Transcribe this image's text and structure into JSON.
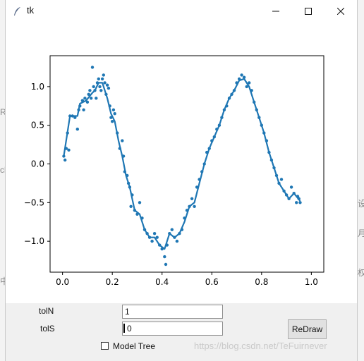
{
  "window": {
    "title": "tk"
  },
  "titlebar_icons": [
    "feather-icon",
    "minimize-icon",
    "maximize-icon",
    "close-icon"
  ],
  "controls": {
    "toln_label": "tolN",
    "toln_value": "1",
    "tols_label": "tolS",
    "tols_value": "0",
    "model_tree_label": "Model Tree",
    "model_tree_checked": false,
    "redraw_label": "ReDraw"
  },
  "watermark": "https://blog.csdn.net/TeFuirnever",
  "background_fragments": [
    "Re",
    "ch",
    "中",
    "设",
    "月",
    "权"
  ],
  "chart_data": {
    "type": "scatter",
    "xlim": [
      -0.05,
      1.05
    ],
    "ylim": [
      -1.4,
      1.4
    ],
    "xticks": [
      0.0,
      0.2,
      0.4,
      0.6,
      0.8,
      1.0
    ],
    "yticks": [
      -1.0,
      -0.5,
      0.0,
      0.5,
      1.0
    ],
    "xtick_labels": [
      "0.0",
      "0.2",
      "0.4",
      "0.6",
      "0.8",
      "1.0"
    ],
    "ytick_labels": [
      "−1.0",
      "−0.5",
      "0.0",
      "0.5",
      "1.0"
    ],
    "color": "#1f77b4",
    "scatter_points": [
      [
        0.005,
        0.1
      ],
      [
        0.01,
        0.05
      ],
      [
        0.015,
        0.2
      ],
      [
        0.02,
        0.4
      ],
      [
        0.025,
        0.18
      ],
      [
        0.03,
        0.62
      ],
      [
        0.04,
        0.62
      ],
      [
        0.05,
        0.6
      ],
      [
        0.06,
        0.45
      ],
      [
        0.065,
        0.7
      ],
      [
        0.07,
        0.75
      ],
      [
        0.08,
        0.82
      ],
      [
        0.085,
        0.7
      ],
      [
        0.09,
        0.85
      ],
      [
        0.1,
        0.8
      ],
      [
        0.105,
        0.9
      ],
      [
        0.11,
        0.95
      ],
      [
        0.115,
        0.85
      ],
      [
        0.12,
        1.25
      ],
      [
        0.125,
        1.0
      ],
      [
        0.13,
        0.95
      ],
      [
        0.135,
        0.85
      ],
      [
        0.14,
        1.05
      ],
      [
        0.145,
        1.1
      ],
      [
        0.15,
        1.0
      ],
      [
        0.155,
        0.95
      ],
      [
        0.16,
        1.1
      ],
      [
        0.165,
        1.15
      ],
      [
        0.17,
        1.05
      ],
      [
        0.175,
        0.9
      ],
      [
        0.18,
        1.02
      ],
      [
        0.185,
        0.98
      ],
      [
        0.19,
        0.75
      ],
      [
        0.195,
        0.6
      ],
      [
        0.2,
        0.55
      ],
      [
        0.205,
        0.7
      ],
      [
        0.21,
        0.65
      ],
      [
        0.22,
        0.4
      ],
      [
        0.23,
        0.2
      ],
      [
        0.24,
        0.3
      ],
      [
        0.245,
        0.1
      ],
      [
        0.25,
        -0.1
      ],
      [
        0.26,
        -0.15
      ],
      [
        0.265,
        -0.25
      ],
      [
        0.27,
        -0.3
      ],
      [
        0.275,
        -0.55
      ],
      [
        0.28,
        -0.4
      ],
      [
        0.29,
        -0.6
      ],
      [
        0.3,
        -0.65
      ],
      [
        0.31,
        -0.5
      ],
      [
        0.32,
        -0.7
      ],
      [
        0.33,
        -0.85
      ],
      [
        0.34,
        -0.9
      ],
      [
        0.35,
        -0.95
      ],
      [
        0.36,
        -1.0
      ],
      [
        0.37,
        -0.9
      ],
      [
        0.38,
        -0.95
      ],
      [
        0.39,
        -1.05
      ],
      [
        0.4,
        -1.1
      ],
      [
        0.41,
        -1.2
      ],
      [
        0.415,
        -1.3
      ],
      [
        0.42,
        -1.05
      ],
      [
        0.43,
        -0.9
      ],
      [
        0.44,
        -0.85
      ],
      [
        0.45,
        -0.95
      ],
      [
        0.46,
        -1.0
      ],
      [
        0.47,
        -0.9
      ],
      [
        0.48,
        -0.85
      ],
      [
        0.49,
        -0.7
      ],
      [
        0.5,
        -0.6
      ],
      [
        0.51,
        -0.55
      ],
      [
        0.52,
        -0.45
      ],
      [
        0.53,
        -0.55
      ],
      [
        0.54,
        -0.3
      ],
      [
        0.55,
        -0.2
      ],
      [
        0.56,
        -0.1
      ],
      [
        0.57,
        0.0
      ],
      [
        0.58,
        0.15
      ],
      [
        0.59,
        0.2
      ],
      [
        0.6,
        0.3
      ],
      [
        0.61,
        0.35
      ],
      [
        0.62,
        0.45
      ],
      [
        0.63,
        0.5
      ],
      [
        0.64,
        0.6
      ],
      [
        0.65,
        0.7
      ],
      [
        0.66,
        0.75
      ],
      [
        0.67,
        0.85
      ],
      [
        0.68,
        0.9
      ],
      [
        0.69,
        0.95
      ],
      [
        0.7,
        1.05
      ],
      [
        0.71,
        1.1
      ],
      [
        0.72,
        1.15
      ],
      [
        0.73,
        1.12
      ],
      [
        0.74,
        1.0
      ],
      [
        0.75,
        1.05
      ],
      [
        0.76,
        0.95
      ],
      [
        0.77,
        0.8
      ],
      [
        0.78,
        0.7
      ],
      [
        0.79,
        0.6
      ],
      [
        0.8,
        0.5
      ],
      [
        0.81,
        0.4
      ],
      [
        0.82,
        0.3
      ],
      [
        0.83,
        0.15
      ],
      [
        0.84,
        0.05
      ],
      [
        0.85,
        -0.05
      ],
      [
        0.86,
        -0.15
      ],
      [
        0.87,
        -0.25
      ],
      [
        0.88,
        -0.2
      ],
      [
        0.89,
        -0.35
      ],
      [
        0.9,
        -0.4
      ],
      [
        0.91,
        -0.45
      ],
      [
        0.92,
        -0.3
      ],
      [
        0.93,
        -0.38
      ],
      [
        0.94,
        -0.5
      ],
      [
        0.945,
        -0.42
      ],
      [
        0.95,
        -0.45
      ],
      [
        0.955,
        -0.5
      ]
    ],
    "line_points": [
      [
        0.005,
        0.1
      ],
      [
        0.03,
        0.62
      ],
      [
        0.06,
        0.62
      ],
      [
        0.07,
        0.78
      ],
      [
        0.095,
        0.82
      ],
      [
        0.12,
        0.92
      ],
      [
        0.13,
        0.95
      ],
      [
        0.145,
        1.05
      ],
      [
        0.16,
        1.05
      ],
      [
        0.17,
        0.95
      ],
      [
        0.18,
        0.85
      ],
      [
        0.195,
        0.65
      ],
      [
        0.21,
        0.55
      ],
      [
        0.225,
        0.3
      ],
      [
        0.24,
        0.1
      ],
      [
        0.255,
        -0.15
      ],
      [
        0.27,
        -0.3
      ],
      [
        0.29,
        -0.6
      ],
      [
        0.31,
        -0.65
      ],
      [
        0.33,
        -0.85
      ],
      [
        0.35,
        -0.95
      ],
      [
        0.37,
        -0.95
      ],
      [
        0.39,
        -1.05
      ],
      [
        0.41,
        -1.1
      ],
      [
        0.43,
        -0.9
      ],
      [
        0.45,
        -0.95
      ],
      [
        0.47,
        -0.9
      ],
      [
        0.49,
        -0.75
      ],
      [
        0.51,
        -0.55
      ],
      [
        0.53,
        -0.5
      ],
      [
        0.55,
        -0.25
      ],
      [
        0.57,
        0.0
      ],
      [
        0.59,
        0.2
      ],
      [
        0.61,
        0.35
      ],
      [
        0.63,
        0.5
      ],
      [
        0.65,
        0.7
      ],
      [
        0.67,
        0.85
      ],
      [
        0.69,
        0.95
      ],
      [
        0.71,
        1.08
      ],
      [
        0.73,
        1.1
      ],
      [
        0.75,
        1.0
      ],
      [
        0.77,
        0.8
      ],
      [
        0.79,
        0.6
      ],
      [
        0.81,
        0.4
      ],
      [
        0.83,
        0.15
      ],
      [
        0.85,
        -0.05
      ],
      [
        0.87,
        -0.25
      ],
      [
        0.89,
        -0.35
      ],
      [
        0.91,
        -0.45
      ],
      [
        0.93,
        -0.38
      ],
      [
        0.955,
        -0.48
      ]
    ]
  }
}
